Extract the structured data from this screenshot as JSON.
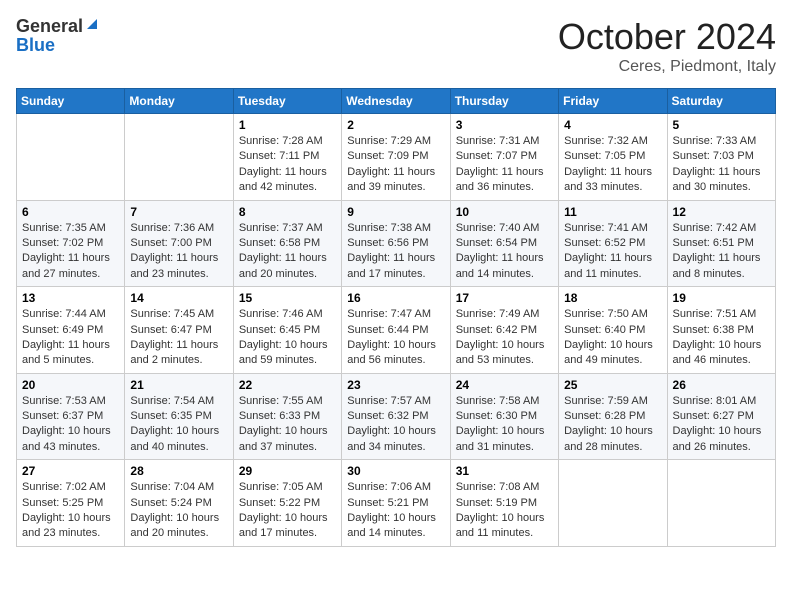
{
  "header": {
    "logo_general": "General",
    "logo_blue": "Blue",
    "month_title": "October 2024",
    "location": "Ceres, Piedmont, Italy"
  },
  "calendar": {
    "days_of_week": [
      "Sunday",
      "Monday",
      "Tuesday",
      "Wednesday",
      "Thursday",
      "Friday",
      "Saturday"
    ],
    "weeks": [
      [
        {
          "day": "",
          "info": ""
        },
        {
          "day": "",
          "info": ""
        },
        {
          "day": "1",
          "info": "Sunrise: 7:28 AM\nSunset: 7:11 PM\nDaylight: 11 hours and 42 minutes."
        },
        {
          "day": "2",
          "info": "Sunrise: 7:29 AM\nSunset: 7:09 PM\nDaylight: 11 hours and 39 minutes."
        },
        {
          "day": "3",
          "info": "Sunrise: 7:31 AM\nSunset: 7:07 PM\nDaylight: 11 hours and 36 minutes."
        },
        {
          "day": "4",
          "info": "Sunrise: 7:32 AM\nSunset: 7:05 PM\nDaylight: 11 hours and 33 minutes."
        },
        {
          "day": "5",
          "info": "Sunrise: 7:33 AM\nSunset: 7:03 PM\nDaylight: 11 hours and 30 minutes."
        }
      ],
      [
        {
          "day": "6",
          "info": "Sunrise: 7:35 AM\nSunset: 7:02 PM\nDaylight: 11 hours and 27 minutes."
        },
        {
          "day": "7",
          "info": "Sunrise: 7:36 AM\nSunset: 7:00 PM\nDaylight: 11 hours and 23 minutes."
        },
        {
          "day": "8",
          "info": "Sunrise: 7:37 AM\nSunset: 6:58 PM\nDaylight: 11 hours and 20 minutes."
        },
        {
          "day": "9",
          "info": "Sunrise: 7:38 AM\nSunset: 6:56 PM\nDaylight: 11 hours and 17 minutes."
        },
        {
          "day": "10",
          "info": "Sunrise: 7:40 AM\nSunset: 6:54 PM\nDaylight: 11 hours and 14 minutes."
        },
        {
          "day": "11",
          "info": "Sunrise: 7:41 AM\nSunset: 6:52 PM\nDaylight: 11 hours and 11 minutes."
        },
        {
          "day": "12",
          "info": "Sunrise: 7:42 AM\nSunset: 6:51 PM\nDaylight: 11 hours and 8 minutes."
        }
      ],
      [
        {
          "day": "13",
          "info": "Sunrise: 7:44 AM\nSunset: 6:49 PM\nDaylight: 11 hours and 5 minutes."
        },
        {
          "day": "14",
          "info": "Sunrise: 7:45 AM\nSunset: 6:47 PM\nDaylight: 11 hours and 2 minutes."
        },
        {
          "day": "15",
          "info": "Sunrise: 7:46 AM\nSunset: 6:45 PM\nDaylight: 10 hours and 59 minutes."
        },
        {
          "day": "16",
          "info": "Sunrise: 7:47 AM\nSunset: 6:44 PM\nDaylight: 10 hours and 56 minutes."
        },
        {
          "day": "17",
          "info": "Sunrise: 7:49 AM\nSunset: 6:42 PM\nDaylight: 10 hours and 53 minutes."
        },
        {
          "day": "18",
          "info": "Sunrise: 7:50 AM\nSunset: 6:40 PM\nDaylight: 10 hours and 49 minutes."
        },
        {
          "day": "19",
          "info": "Sunrise: 7:51 AM\nSunset: 6:38 PM\nDaylight: 10 hours and 46 minutes."
        }
      ],
      [
        {
          "day": "20",
          "info": "Sunrise: 7:53 AM\nSunset: 6:37 PM\nDaylight: 10 hours and 43 minutes."
        },
        {
          "day": "21",
          "info": "Sunrise: 7:54 AM\nSunset: 6:35 PM\nDaylight: 10 hours and 40 minutes."
        },
        {
          "day": "22",
          "info": "Sunrise: 7:55 AM\nSunset: 6:33 PM\nDaylight: 10 hours and 37 minutes."
        },
        {
          "day": "23",
          "info": "Sunrise: 7:57 AM\nSunset: 6:32 PM\nDaylight: 10 hours and 34 minutes."
        },
        {
          "day": "24",
          "info": "Sunrise: 7:58 AM\nSunset: 6:30 PM\nDaylight: 10 hours and 31 minutes."
        },
        {
          "day": "25",
          "info": "Sunrise: 7:59 AM\nSunset: 6:28 PM\nDaylight: 10 hours and 28 minutes."
        },
        {
          "day": "26",
          "info": "Sunrise: 8:01 AM\nSunset: 6:27 PM\nDaylight: 10 hours and 26 minutes."
        }
      ],
      [
        {
          "day": "27",
          "info": "Sunrise: 7:02 AM\nSunset: 5:25 PM\nDaylight: 10 hours and 23 minutes."
        },
        {
          "day": "28",
          "info": "Sunrise: 7:04 AM\nSunset: 5:24 PM\nDaylight: 10 hours and 20 minutes."
        },
        {
          "day": "29",
          "info": "Sunrise: 7:05 AM\nSunset: 5:22 PM\nDaylight: 10 hours and 17 minutes."
        },
        {
          "day": "30",
          "info": "Sunrise: 7:06 AM\nSunset: 5:21 PM\nDaylight: 10 hours and 14 minutes."
        },
        {
          "day": "31",
          "info": "Sunrise: 7:08 AM\nSunset: 5:19 PM\nDaylight: 10 hours and 11 minutes."
        },
        {
          "day": "",
          "info": ""
        },
        {
          "day": "",
          "info": ""
        }
      ]
    ]
  }
}
